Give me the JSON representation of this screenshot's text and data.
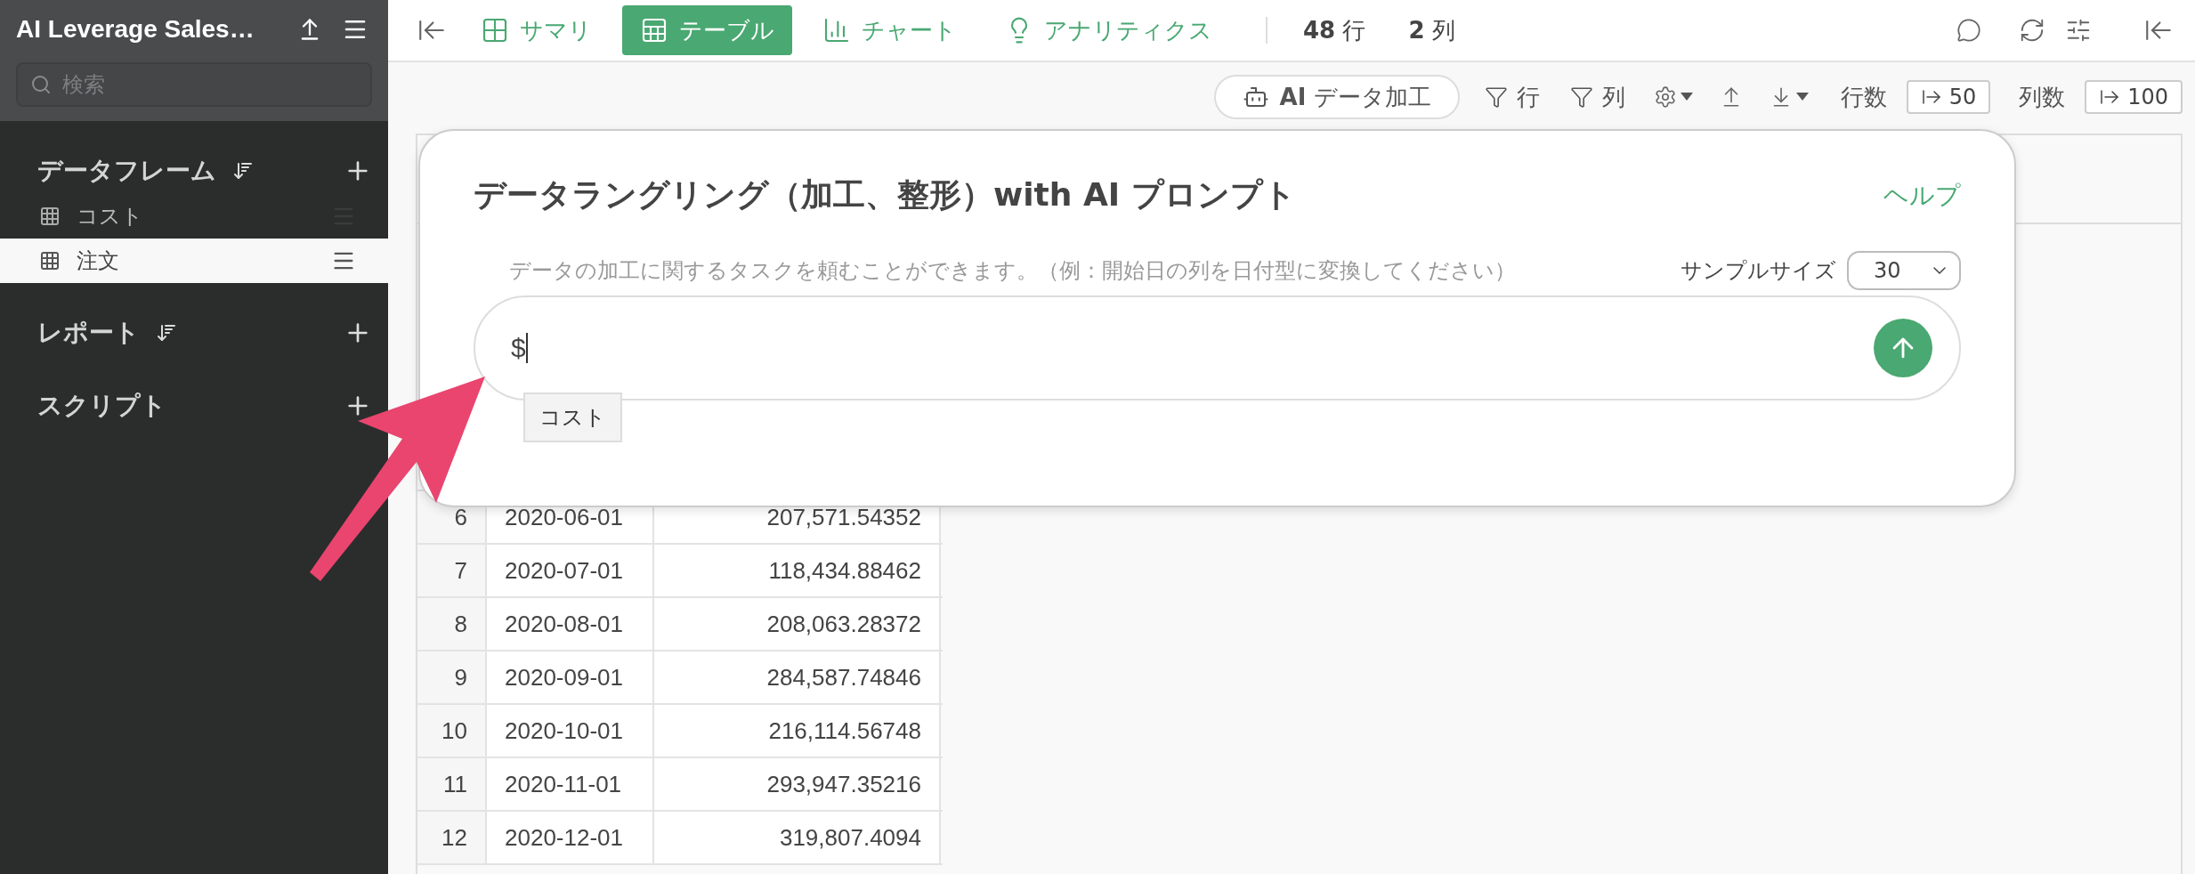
{
  "sidebar": {
    "title": "AI Leverage Sales…",
    "search": {
      "placeholder": "検索"
    },
    "sections": [
      {
        "label": "データフレーム",
        "sortable": true,
        "items": [
          {
            "label": "コスト",
            "selected": false
          },
          {
            "label": "注文",
            "selected": true
          }
        ]
      },
      {
        "label": "レポート",
        "sortable": true
      },
      {
        "label": "スクリプト",
        "sortable": false
      }
    ]
  },
  "topbar": {
    "tabs": [
      {
        "label": "サマリ",
        "selected": false
      },
      {
        "label": "テーブル",
        "selected": true
      },
      {
        "label": "チャート",
        "selected": false
      },
      {
        "label": "アナリティクス",
        "selected": false
      }
    ],
    "stats": [
      {
        "value": "48",
        "unit": "行"
      },
      {
        "value": "2",
        "unit": "列"
      }
    ]
  },
  "toolbar": {
    "ai_button": "**AI** データ加工",
    "filters": [
      "行",
      "列"
    ],
    "limits": [
      {
        "label": "行数",
        "value": "50"
      },
      {
        "label": "列数",
        "value": "100"
      }
    ]
  },
  "dialog": {
    "title": "データラングリング（加工、整形）with AI プロンプト",
    "help": "ヘルプ",
    "hint": "データの加工に関するタスクを頼むことができます。（例：開始日の列を日付型に変換してください）",
    "sample_size": {
      "label": "サンプルサイズ",
      "value": "30"
    },
    "prompt": {
      "value": "$"
    },
    "suggestions": [
      "コスト"
    ]
  },
  "table": {
    "rows": [
      [
        "6",
        "2020-06-01",
        "207,571.54352"
      ],
      [
        "7",
        "2020-07-01",
        "118,434.88462"
      ],
      [
        "8",
        "2020-08-01",
        "208,063.28372"
      ],
      [
        "9",
        "2020-09-01",
        "284,587.74846"
      ],
      [
        "10",
        "2020-10-01",
        "216,114.56748"
      ],
      [
        "11",
        "2020-11-01",
        "293,947.35216"
      ],
      [
        "12",
        "2020-12-01",
        "319,807.4094"
      ]
    ]
  }
}
